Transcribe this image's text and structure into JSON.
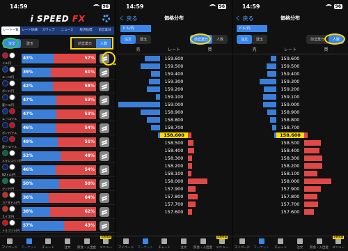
{
  "status": {
    "time": "14:59",
    "battery": "96"
  },
  "panel1": {
    "logo_main": "i SPEED ",
    "logo_fx": "FX",
    "tabs": [
      "レート一覧",
      "レート詳細",
      "スワップ",
      "ニュース",
      "経済指標",
      "前営業日"
    ],
    "toggle": [
      "注文",
      "建玉"
    ],
    "toggle2": [
      "前営業日",
      "人数"
    ],
    "rows": [
      {
        "pair": "ドル/円",
        "sell": "43%",
        "buy": "57%",
        "s": 43,
        "c1": "#c8102e",
        "c2": "#fff"
      },
      {
        "pair": "ユーロ/円",
        "sell": "39%",
        "buy": "61%",
        "s": 39,
        "c1": "#003399",
        "c2": "#fff"
      },
      {
        "pair": "ポンド/円",
        "sell": "42%",
        "buy": "58%",
        "s": 42,
        "c1": "#012169",
        "c2": "#fff"
      },
      {
        "pair": "豪ドル/円",
        "sell": "47%",
        "buy": "53%",
        "s": 47,
        "c1": "#012169",
        "c2": "#fff"
      },
      {
        "pair": "ユーロ/ドル",
        "sell": "47%",
        "buy": "53%",
        "s": 47,
        "c1": "#003399",
        "c2": "#c8102e"
      },
      {
        "pair": "ポンド/ドル",
        "sell": "46%",
        "buy": "54%",
        "s": 46,
        "c1": "#012169",
        "c2": "#c8102e"
      },
      {
        "pair": "豪ドル/ドル",
        "sell": "49%",
        "buy": "51%",
        "s": 49,
        "c1": "#012169",
        "c2": "#c8102e"
      },
      {
        "pair": "メキシコペソ/円",
        "sell": "52%",
        "buy": "48%",
        "s": 52,
        "c1": "#006847",
        "c2": "#fff"
      },
      {
        "pair": "NZドル/円",
        "sell": "46%",
        "buy": "54%",
        "s": 46,
        "c1": "#012169",
        "c2": "#fff"
      },
      {
        "pair": "ランド/円",
        "sell": "50%",
        "buy": "50%",
        "s": 50,
        "c1": "#007a4d",
        "c2": "#fff"
      },
      {
        "pair": "カナダドル/円",
        "sell": "36%",
        "buy": "64%",
        "s": 36,
        "c1": "#d52b1e",
        "c2": "#fff"
      },
      {
        "pair": "スイス/円",
        "sell": "38%",
        "buy": "62%",
        "s": 38,
        "c1": "#d52b1e",
        "c2": "#fff"
      },
      {
        "pair": "トルコリラ/円",
        "sell": "57%",
        "buy": "43%",
        "s": 57,
        "c1": "#e30a17",
        "c2": "#fff"
      }
    ]
  },
  "tabbar": {
    "items": [
      "マイページ",
      "マーケット",
      "チャート",
      "注文",
      "照会・入出金",
      "メニュー"
    ],
    "active": 1,
    "badges": [
      "",
      "",
      "",
      "",
      "",
      "新着情報"
    ]
  },
  "ladder": {
    "title": "価格分布",
    "back": "く 戻る",
    "pair": "ドル/円",
    "toggle": [
      "注文",
      "建玉"
    ],
    "toggle2": [
      "前営業日",
      "人数"
    ],
    "head": [
      "売",
      "レート",
      "買"
    ],
    "highlight": "158.600",
    "rates": [
      "159.600",
      "159.500",
      "159.400",
      "159.300",
      "159.200",
      "159.100",
      "159.000",
      "158.900",
      "158.800",
      "158.700",
      "158.600",
      "158.500",
      "158.400",
      "158.300",
      "158.200",
      "158.100",
      "158.000",
      "157.900",
      "157.800",
      "157.700",
      "157.600"
    ]
  },
  "panel2_levels": {
    "sell": [
      0.35,
      0.45,
      0.2,
      0.25,
      0.3,
      0.1,
      0.95,
      0.45,
      0.3,
      0.2,
      0.05,
      0,
      0,
      0,
      0,
      0,
      0,
      0,
      0,
      0,
      0
    ],
    "buy": [
      0,
      0,
      0,
      0,
      0,
      0,
      0,
      0,
      0,
      0,
      0.08,
      0.12,
      0.14,
      0.1,
      0.1,
      0.08,
      0.45,
      0.18,
      0.22,
      0.18,
      0.1
    ]
  },
  "panel3_levels": {
    "sell": [
      0.12,
      0.22,
      0.2,
      0.38,
      0.28,
      0.3,
      0.3,
      0.2,
      0.15,
      0.1,
      0.05,
      0,
      0,
      0,
      0,
      0,
      0,
      0,
      0,
      0,
      0
    ],
    "buy": [
      0,
      0,
      0,
      0,
      0,
      0,
      0,
      0,
      0,
      0,
      0.08,
      0.38,
      0.35,
      0.42,
      0.42,
      0.3,
      0.62,
      0.38,
      0.3,
      0.32,
      0.22
    ]
  }
}
